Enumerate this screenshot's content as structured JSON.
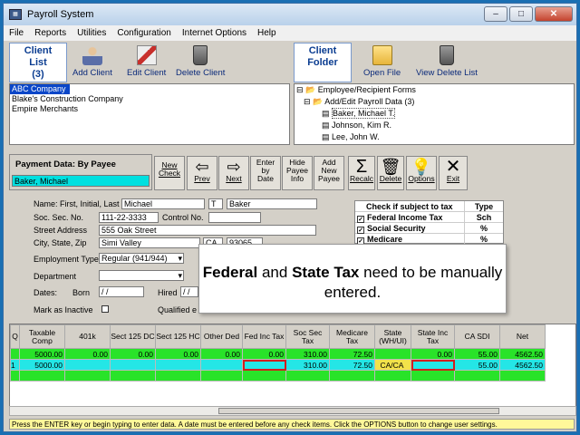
{
  "window": {
    "title": "Payroll System",
    "app_icon": "payroll-app-icon"
  },
  "menu": [
    "File",
    "Reports",
    "Utilities",
    "Configuration",
    "Internet Options",
    "Help"
  ],
  "client_toolbar": {
    "client_list_label": "Client List",
    "client_count": "(3)",
    "add_client": "Add Client",
    "edit_client": "Edit Client",
    "delete_client": "Delete Client"
  },
  "folder_toolbar": {
    "client_folder_label": "Client Folder",
    "open_file": "Open File",
    "view_delete_list": "View Delete List"
  },
  "clients": [
    "ABC Company",
    "Blake's Construction Company",
    "Empire Merchants"
  ],
  "tree": {
    "root": "Employee/Recipient Forms",
    "child": "Add/Edit Payroll Data  (3)",
    "employees": [
      "Baker, Michael T.",
      "Johnson, Kim R.",
      "Lee, John W."
    ]
  },
  "payment": {
    "title": "Payment Data: By Payee",
    "payee": "Baker, Michael"
  },
  "nav_buttons": {
    "new_check": "New Check",
    "prev": "Prev",
    "next": "Next",
    "enter_by_date": "Enter by Date",
    "hide_payee_info": "Hide Payee Info",
    "add_new_payee": "Add New Payee",
    "recalc": "Recalc",
    "delete": "Delete",
    "options": "Options",
    "exit": "Exit"
  },
  "form": {
    "name_label": "Name: First, Initial, Last",
    "first": "Michael",
    "initial": "T",
    "last": "Baker",
    "ssn_label": "Soc. Sec. No.",
    "ssn": "111-22-3333",
    "control_label": "Control No.",
    "control": "",
    "street_label": "Street Address",
    "street": "555 Oak Street",
    "city_label": "City, State, Zip",
    "city": "Simi Valley",
    "state": "CA",
    "zip": "93065",
    "emp_type_label": "Employment Type",
    "emp_type": "Regular (941/944)",
    "dept_label": "Department",
    "dept": "",
    "dates_label": "Dates:",
    "born_label": "Born",
    "born": "/ /",
    "hired_label": "Hired",
    "hired": "/ /",
    "inactive_label": "Mark as Inactive",
    "qualified_label": "Qualified e"
  },
  "check_panel": {
    "header1": "Check if subject to tax",
    "header2": "Type",
    "rows": [
      {
        "label": "Federal Income Tax",
        "type": "Sch"
      },
      {
        "label": "Social Security",
        "type": "%"
      },
      {
        "label": "Medicare",
        "type": "%"
      }
    ]
  },
  "callout": {
    "bold1": "Federal",
    "mid": " and ",
    "bold2": "State Tax",
    "rest": " need to be manually entered."
  },
  "grid": {
    "headers": [
      "Q",
      "Taxable Comp",
      "401k",
      "Sect 125 DC",
      "Sect 125 HC",
      "Other Ded",
      "Fed Inc Tax",
      "Soc Sec Tax",
      "Medicare Tax",
      "State (WH/UI)",
      "State Inc Tax",
      "CA SDI",
      "Net"
    ],
    "rows": [
      [
        "",
        "5000.00",
        "0.00",
        "0.00",
        "0.00",
        "0.00",
        "0.00",
        "310.00",
        "72.50",
        "",
        "0.00",
        "55.00",
        "4562.50"
      ],
      [
        "1",
        "5000.00",
        "",
        "",
        "",
        "",
        "",
        "310.00",
        "72.50",
        "CA/CA",
        "",
        "55.00",
        "4562.50"
      ]
    ]
  },
  "status": "Press the ENTER key or begin typing to enter data.  A date must be entered before any check items.  Click the OPTIONS button to change user settings."
}
